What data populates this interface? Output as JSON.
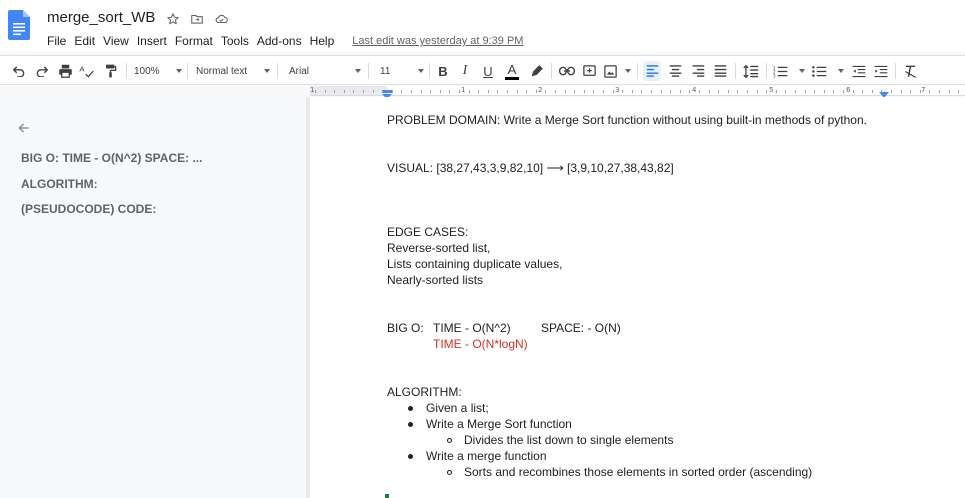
{
  "app": {
    "title": "merge_sort_WB",
    "last_edit": "Last edit was yesterday at 9:39 PM",
    "menu": [
      "File",
      "Edit",
      "View",
      "Insert",
      "Format",
      "Tools",
      "Add-ons",
      "Help"
    ]
  },
  "toolbar": {
    "zoom": "100%",
    "style": "Normal text",
    "font": "Arial",
    "size": "11",
    "bold": "B",
    "italic": "I",
    "underline": "U",
    "text_color": "A",
    "text_color_hex": "#000000"
  },
  "ruler": {
    "numbers": [
      "1",
      "1",
      "2",
      "3",
      "4",
      "5",
      "6",
      "7"
    ]
  },
  "outline": {
    "items": [
      "BIG O: TIME - O(N^2) SPACE: ...",
      "ALGORITHM:",
      "(PSEUDOCODE) CODE:"
    ]
  },
  "document": {
    "problem": "PROBLEM DOMAIN:  Write a Merge Sort function without using built-in methods of python.",
    "visual": "VISUAL:   [38,27,43,3,9,82,10] ⟶ [3,9,10,27,38,43,82]",
    "edge_heading": "EDGE CASES:",
    "edge_cases": [
      "Reverse-sorted list,",
      "Lists containing duplicate values,",
      "Nearly-sorted lists"
    ],
    "bigo_label": "BIG O:",
    "bigo_time": "TIME - O(N^2)",
    "bigo_space": "SPACE: - O(N)",
    "bigo_correction": "TIME - O(N*logN)",
    "correction_color": "#d93025",
    "algorithm_heading": "ALGORITHM:",
    "algorithm": [
      "Given a list;",
      "Write a Merge Sort function",
      "Divides the list down to single elements",
      "Write a merge function",
      "Sorts and recombines those elements in sorted order (ascending)"
    ]
  }
}
